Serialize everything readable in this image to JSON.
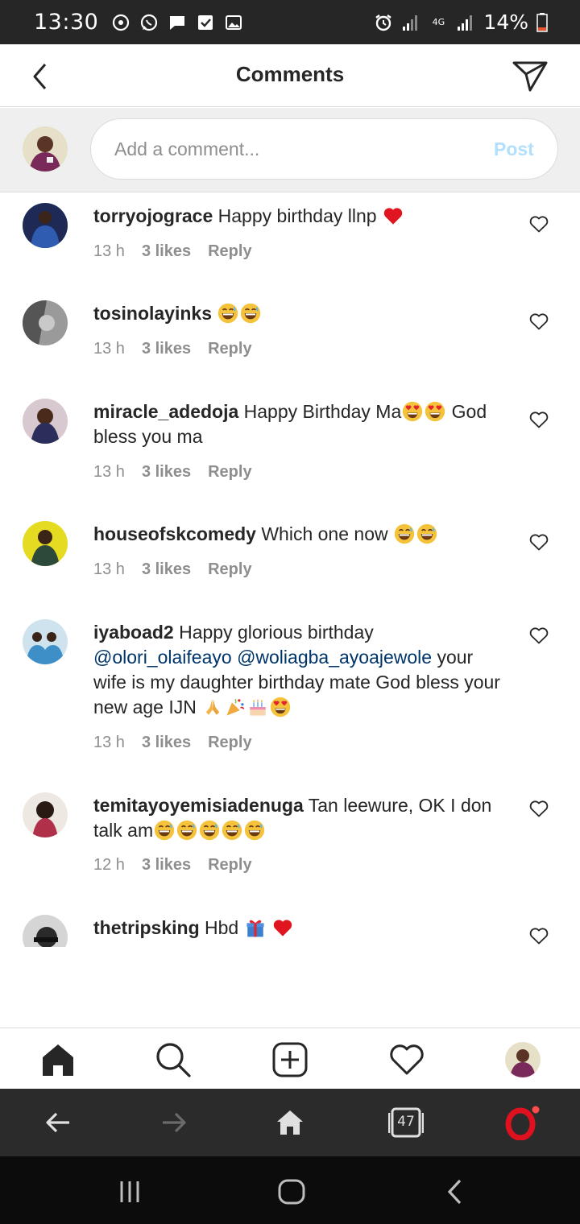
{
  "status_bar": {
    "time": "13:30",
    "battery_percent": "14%",
    "network": "4G"
  },
  "header": {
    "title": "Comments"
  },
  "composer": {
    "placeholder": "Add a comment...",
    "post_label": "Post"
  },
  "comments": [
    {
      "username": "torryojograce",
      "text": " Happy birthday llnp ",
      "emojis": [
        "red-heart"
      ],
      "time": "13 h",
      "likes": "3 likes",
      "reply": "Reply",
      "avatar_color": "#2a3f7a"
    },
    {
      "username": "tosinolayinks",
      "text": " ",
      "emojis": [
        "grinning-sweat",
        "grinning-sweat"
      ],
      "time": "13 h",
      "likes": "3 likes",
      "reply": "Reply",
      "avatar_color": "#777777"
    },
    {
      "username": "miracle_adedoja",
      "text": " Happy Birthday Ma",
      "emojis_mid": [
        "heart-eyes",
        "heart-eyes"
      ],
      "text_after": " God bless you ma",
      "time": "13 h",
      "likes": "3 likes",
      "reply": "Reply",
      "avatar_color": "#3b2b4d"
    },
    {
      "username": "houseofskcomedy",
      "text": " Which one now ",
      "emojis": [
        "grinning-sweat",
        "grinning-sweat"
      ],
      "time": "13 h",
      "likes": "3 likes",
      "reply": "Reply",
      "avatar_color": "#d8cf1a"
    },
    {
      "username": "iyaboad2",
      "text": " Happy glorious birthday ",
      "mention1": "@olori_olaifeayo",
      "mention2": "@woliagba_ayoajewole",
      "text_after": " your wife is my daughter birthday mate God bless your new age IJN ",
      "emojis": [
        "folded-hands",
        "party-popper",
        "birthday-cake",
        "heart-eyes"
      ],
      "time": "13 h",
      "likes": "3 likes",
      "reply": "Reply",
      "avatar_color": "#5aa0c8"
    },
    {
      "username": "temitayoyemisiadenuga",
      "text": " Tan leewure, OK I don talk am",
      "emojis": [
        "grinning-sweat",
        "grinning-sweat",
        "grinning-sweat",
        "grinning-sweat",
        "grinning-sweat"
      ],
      "time": "12 h",
      "likes": "3 likes",
      "reply": "Reply",
      "avatar_color": "#5a3a30"
    },
    {
      "username": "thetripsking",
      "text": " Hbd ",
      "emojis": [
        "wrapped-gift",
        "red-heart"
      ],
      "avatar_color": "#555555"
    }
  ],
  "tab_bar": {
    "items": [
      "home-icon",
      "search-icon",
      "new-post-icon",
      "activity-heart-icon",
      "profile-avatar"
    ]
  },
  "browser_bar": {
    "tab_count": "47"
  },
  "colors": {
    "status_bar": "#262626",
    "post_disabled": "#b2dffc",
    "mention": "#003569",
    "muted_text": "#8e8e8e",
    "opera_red": "#e0111f"
  }
}
